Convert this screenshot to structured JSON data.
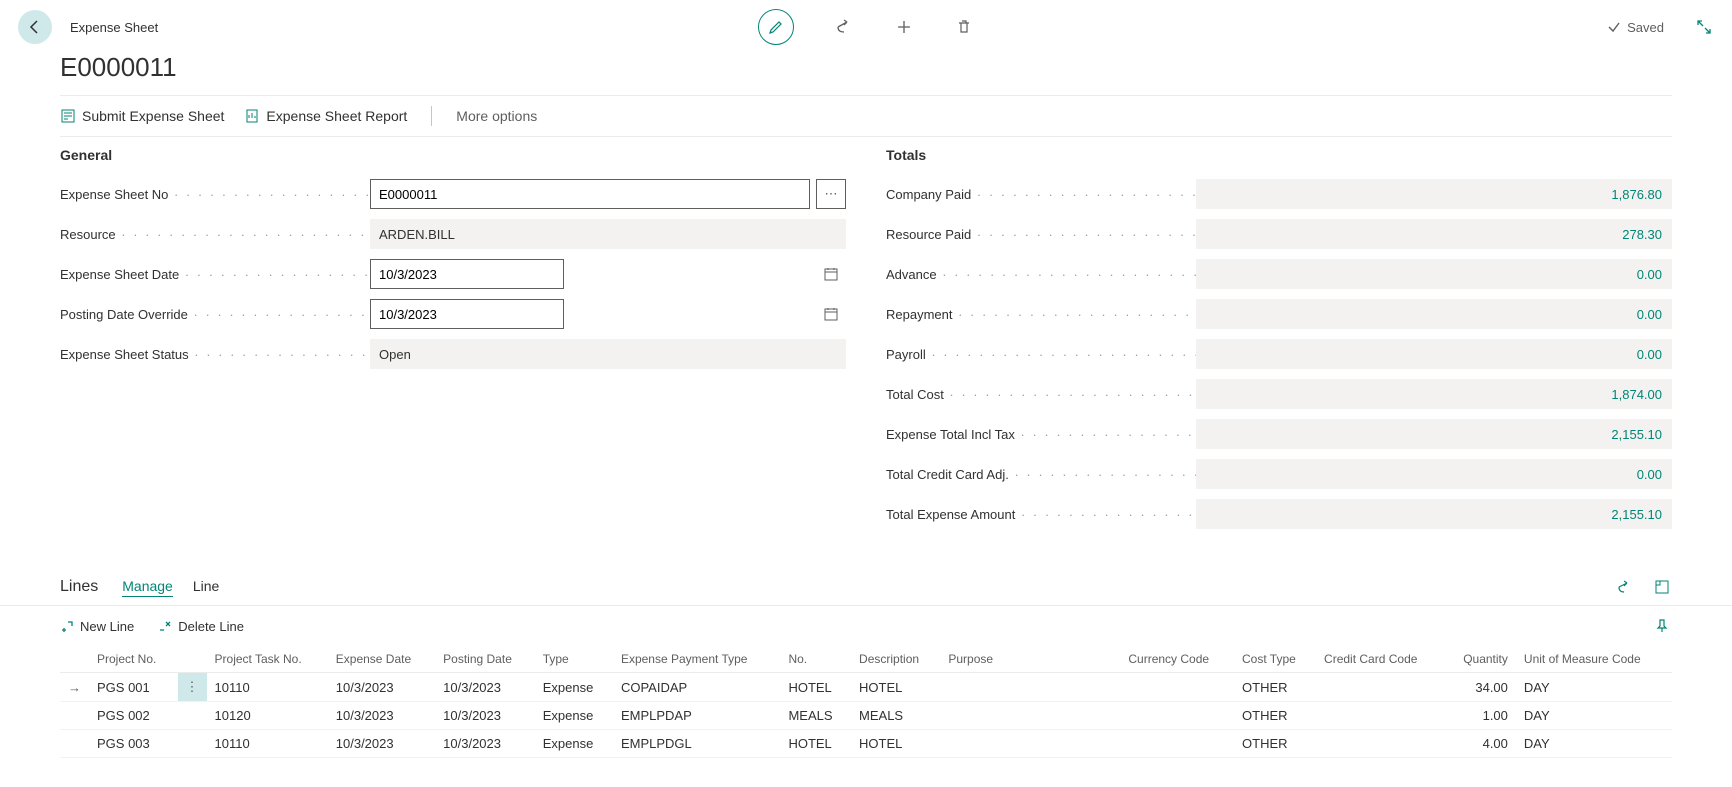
{
  "header": {
    "breadcrumb": "Expense Sheet",
    "saved_label": "Saved",
    "page_title": "E0000011"
  },
  "actions": {
    "submit": "Submit Expense Sheet",
    "report": "Expense Sheet Report",
    "more": "More options"
  },
  "general": {
    "title": "General",
    "fields": {
      "no_label": "Expense Sheet No",
      "no_value": "E0000011",
      "resource_label": "Resource",
      "resource_value": "ARDEN.BILL",
      "date_label": "Expense Sheet Date",
      "date_value": "10/3/2023",
      "posting_label": "Posting Date Override",
      "posting_value": "10/3/2023",
      "status_label": "Expense Sheet Status",
      "status_value": "Open"
    }
  },
  "totals": {
    "title": "Totals",
    "fields": [
      {
        "label": "Company Paid",
        "value": "1,876.80"
      },
      {
        "label": "Resource Paid",
        "value": "278.30"
      },
      {
        "label": "Advance",
        "value": "0.00"
      },
      {
        "label": "Repayment",
        "value": "0.00"
      },
      {
        "label": "Payroll",
        "value": "0.00"
      },
      {
        "label": "Total Cost",
        "value": "1,874.00"
      },
      {
        "label": "Expense Total Incl Tax",
        "value": "2,155.10"
      },
      {
        "label": "Total Credit Card Adj.",
        "value": "0.00"
      },
      {
        "label": "Total Expense Amount",
        "value": "2,155.10"
      }
    ]
  },
  "lines": {
    "title": "Lines",
    "tabs": {
      "manage": "Manage",
      "line": "Line"
    },
    "tools": {
      "new": "New Line",
      "delete": "Delete Line"
    },
    "columns": {
      "project_no": "Project No.",
      "project_task": "Project Task No.",
      "expense_date": "Expense Date",
      "posting_date": "Posting Date",
      "type": "Type",
      "payment_type": "Expense Payment Type",
      "no": "No.",
      "description": "Description",
      "purpose": "Purpose",
      "currency": "Currency Code",
      "cost_type": "Cost Type",
      "cc_code": "Credit Card Code",
      "quantity": "Quantity",
      "uom": "Unit of Measure Code"
    },
    "rows": [
      {
        "project_no": "PGS 001",
        "project_task": "10110",
        "expense_date": "10/3/2023",
        "posting_date": "10/3/2023",
        "type": "Expense",
        "payment_type": "COPAIDAP",
        "no": "HOTEL",
        "description": "HOTEL",
        "purpose": "",
        "currency": "",
        "cost_type": "OTHER",
        "cc_code": "",
        "quantity": "34.00",
        "uom": "DAY",
        "selected": true
      },
      {
        "project_no": "PGS 002",
        "project_task": "10120",
        "expense_date": "10/3/2023",
        "posting_date": "10/3/2023",
        "type": "Expense",
        "payment_type": "EMPLPDAP",
        "no": "MEALS",
        "description": "MEALS",
        "purpose": "",
        "currency": "",
        "cost_type": "OTHER",
        "cc_code": "",
        "quantity": "1.00",
        "uom": "DAY",
        "selected": false
      },
      {
        "project_no": "PGS 003",
        "project_task": "10110",
        "expense_date": "10/3/2023",
        "posting_date": "10/3/2023",
        "type": "Expense",
        "payment_type": "EMPLPDGL",
        "no": "HOTEL",
        "description": "HOTEL",
        "purpose": "",
        "currency": "",
        "cost_type": "OTHER",
        "cc_code": "",
        "quantity": "4.00",
        "uom": "DAY",
        "selected": false
      }
    ]
  }
}
